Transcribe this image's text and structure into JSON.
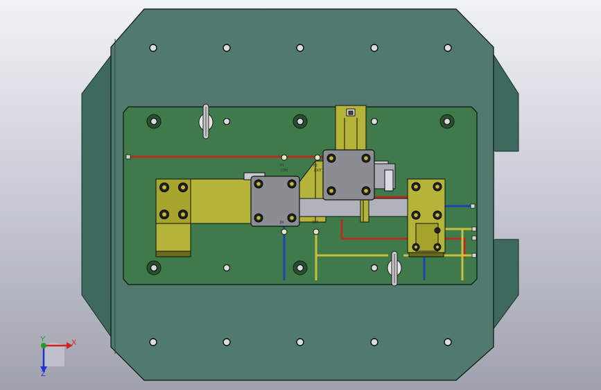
{
  "triad": {
    "x_label": "X",
    "y_label": "Y",
    "z_label": "Z",
    "x_color": "#d42020",
    "y_color": "#20a020",
    "z_color": "#2030d0"
  },
  "annotations": {
    "port_a": "P1",
    "port_a_sub": "(IN)",
    "port_b": "P2",
    "port_b_sub": "(OUT)",
    "port_c": "IN",
    "port_d": "OUT"
  },
  "colors": {
    "base_plate": "#4f7a6d",
    "top_plate": "#3f7a4a",
    "block_olive": "#b4b43a",
    "block_grey": "#8a8d91",
    "line_red": "#b03020",
    "line_blue": "#2040b0",
    "line_yellow": "#c8c040"
  }
}
